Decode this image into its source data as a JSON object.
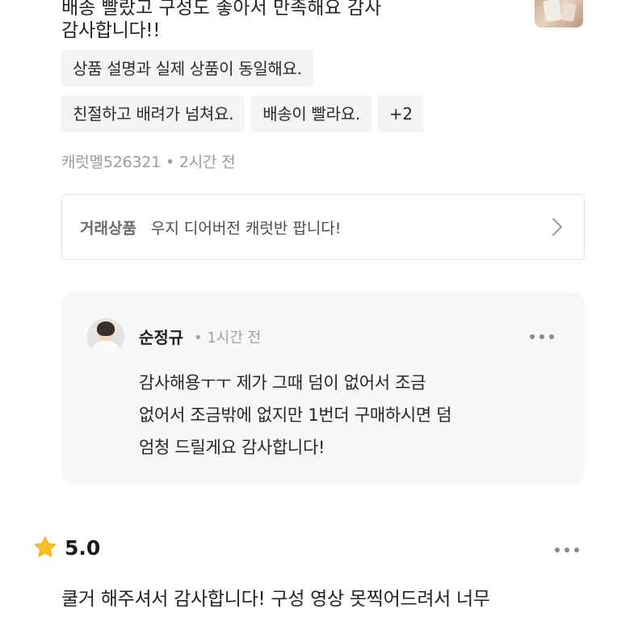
{
  "review_top": {
    "cutoff_text": "배송 빨랐고 구성도 좋아서 만족해요 감사",
    "thanks_text": "감사합니다!!",
    "tags_row1": [
      "상품 설명과 실제 상품이 동일해요."
    ],
    "tags_row2": [
      "친절하고 배려가 넘쳐요.",
      "배송이 빨라요.",
      "+2"
    ],
    "author": "캐럿멜526321",
    "separator": " • ",
    "time": "2시간 전"
  },
  "trade": {
    "label": "거래상품",
    "title": "우지 디어버전 캐럿반 팝니다!"
  },
  "reply": {
    "name": "순정규",
    "time": "• 1시간 전",
    "lines": [
      "감사해용ㅜㅜ 제가 그때 덤이 없어서 조금",
      "없어서 조금밖에 없지만 1번더 구매하시면 덤",
      "엄청 드릴게요 감사합니다!"
    ]
  },
  "review_next": {
    "rating": "5.0",
    "text": "쿨거 해주셔서 감사합니다! 구성 영상 못찍어드려서 너무"
  },
  "colors": {
    "tag_bg": "#f3f4f6",
    "reply_bg": "#f6f7f9",
    "star": "#fbbf24",
    "muted": "#9a9a9a"
  },
  "icons": [
    "chevron-right-icon",
    "more-icon",
    "star-icon",
    "avatar"
  ]
}
